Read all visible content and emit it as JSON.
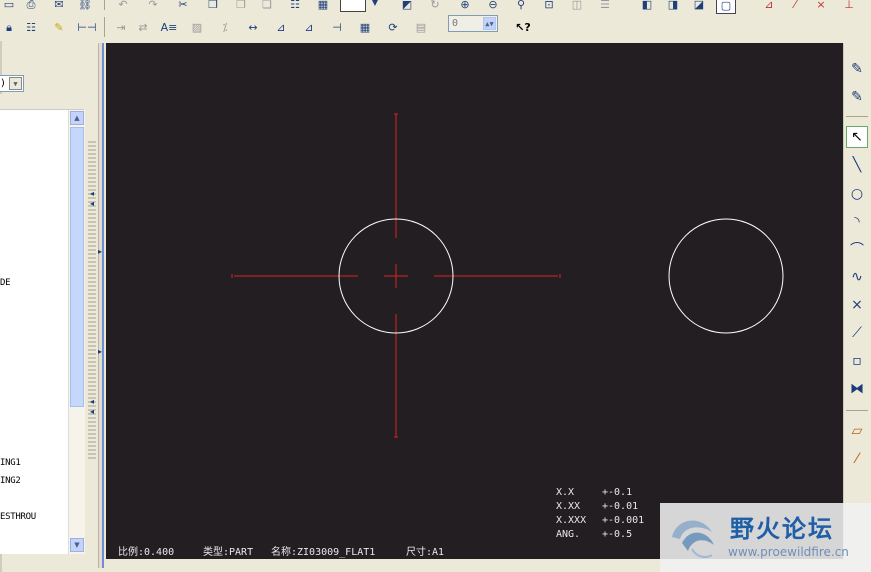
{
  "toolbar": {
    "row1_icons": [
      "undo-icon",
      "redo-icon",
      "cut-icon",
      "copy-icon",
      "paste-icon",
      "paste-special-icon",
      "regenerate-icon",
      "model-tree-icon",
      "find-icon",
      "select-box-icon",
      "repaint-icon",
      "spin-center-icon",
      "zoom-in-icon",
      "zoom-out-icon",
      "zoom-fit-icon",
      "orient-icon",
      "saved-views-icon",
      "shaded-icon",
      "hidden-line-icon",
      "no-hidden-icon",
      "wireframe-icon",
      "datum-planes-icon",
      "datum-axes-icon",
      "datum-points-icon",
      "datum-csys-icon"
    ],
    "line_width_value": "0",
    "whats_this_icon": "help-arrow-icon"
  },
  "navigator": {
    "tree_items": [
      "DE",
      "ING1",
      "ING2",
      "ESTHROU"
    ]
  },
  "status_bar": {
    "scale": "比例:0.400",
    "type": "类型:PART",
    "name": "名称:ZI03009_FLAT1",
    "size": "尺寸:A1"
  },
  "tolerance_table": {
    "rows": [
      {
        "format": "X.X",
        "value": "+-0.1"
      },
      {
        "format": "X.XX",
        "value": "+-0.01"
      },
      {
        "format": "X.XXX",
        "value": "+-0.001"
      },
      {
        "format": "ANG.",
        "value": "+-0.5"
      }
    ]
  },
  "watermark": {
    "title": "野火论坛",
    "url": "www.proewildfire.cn"
  },
  "colors": {
    "canvas_bg": "#221e22",
    "geometry": "#ffffff",
    "centerline": "#d8242c"
  }
}
